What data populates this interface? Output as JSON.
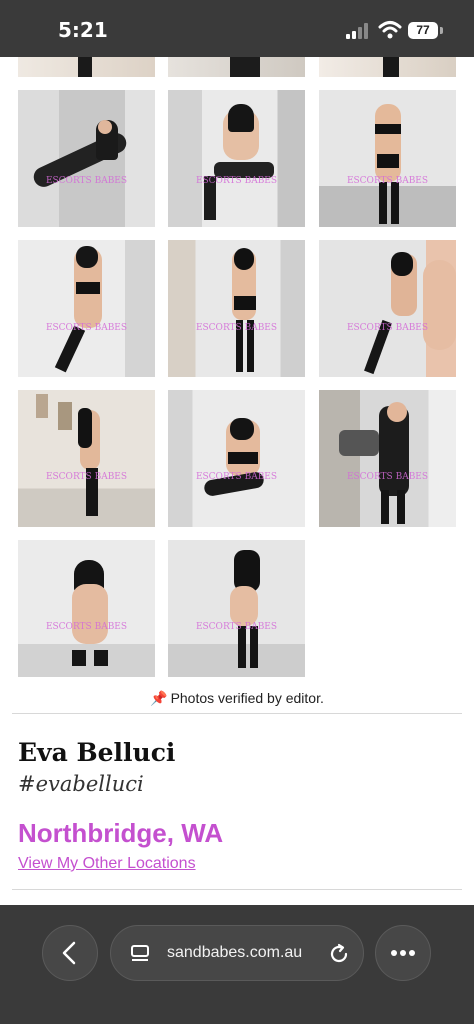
{
  "status_bar": {
    "time": "5:21",
    "battery": "77"
  },
  "gallery": {
    "watermark": "ESCORTS BABES",
    "photos": [
      {
        "caption": "partial top left"
      },
      {
        "caption": "partial top middle"
      },
      {
        "caption": "partial top right"
      }
    ]
  },
  "profile": {
    "verified_text": "Photos verified by editor.",
    "name": "Eva Belluci",
    "handle": "#evabelluci",
    "location": "Northbridge, WA",
    "other_locations_link": "View My Other Locations"
  },
  "browser": {
    "url": "sandbabes.com.au",
    "icons": [
      "back-icon",
      "tab-icon",
      "reload-icon",
      "more-icon"
    ]
  },
  "colors": {
    "accent": "#c450cf",
    "bar": "#3a3a3a"
  }
}
